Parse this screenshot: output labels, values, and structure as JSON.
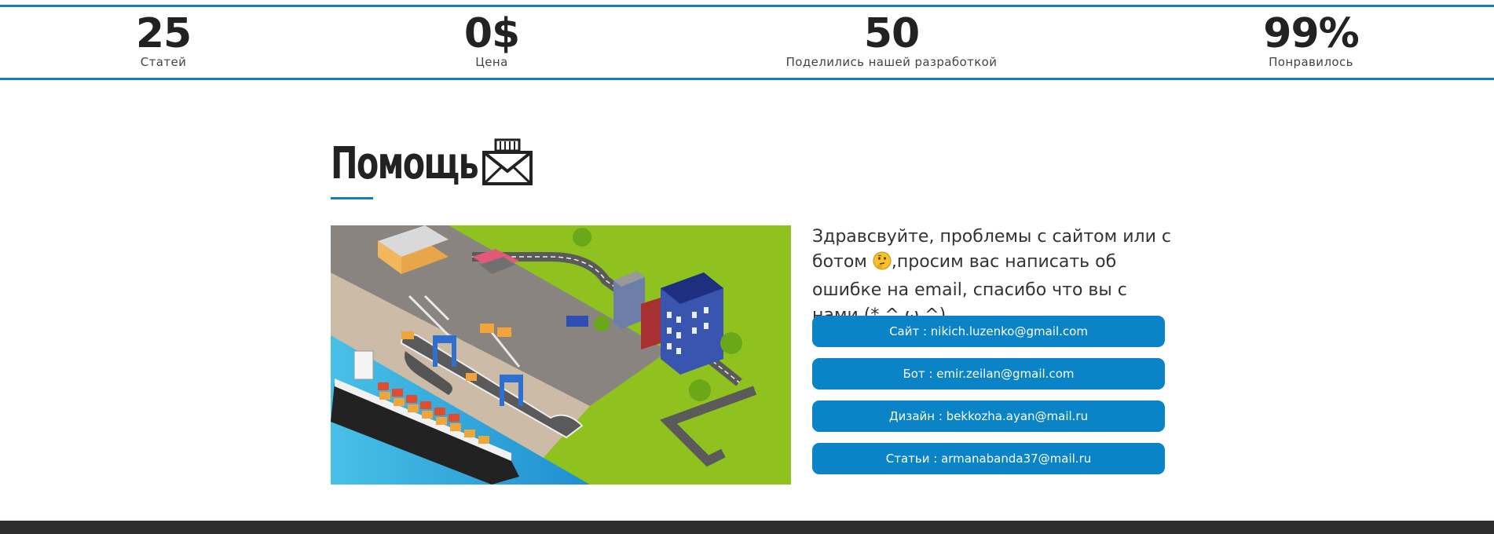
{
  "stats": [
    {
      "value": "25",
      "label": "Статей"
    },
    {
      "value": "0$",
      "label": "Цена"
    },
    {
      "value": "50",
      "label": "Поделились нашей разработкой"
    },
    {
      "value": "99%",
      "label": "Понравилось"
    }
  ],
  "help": {
    "title": "Помощь",
    "icon": "envelope-icon",
    "intro_part1": "Здравсвуйте, проблемы с сайтом или с ботом",
    "intro_emoji": "thinking-face-icon",
    "intro_part2": ",просим вас написать об ошибке на email, спасибо что вы с нами (* ^ ω ^)",
    "contacts": [
      {
        "label": "Сайт : nikich.luzenko@gmail.com"
      },
      {
        "label": "Бот : emir.zeilan@gmail.com"
      },
      {
        "label": "Дизайн : bekkozha.ayan@mail.ru"
      },
      {
        "label": "Статьи : armanabanda37@mail.ru"
      }
    ]
  },
  "colors": {
    "accent": "#0f7fc0",
    "button": "#0a84c6",
    "footer": "#2d2d2d"
  }
}
